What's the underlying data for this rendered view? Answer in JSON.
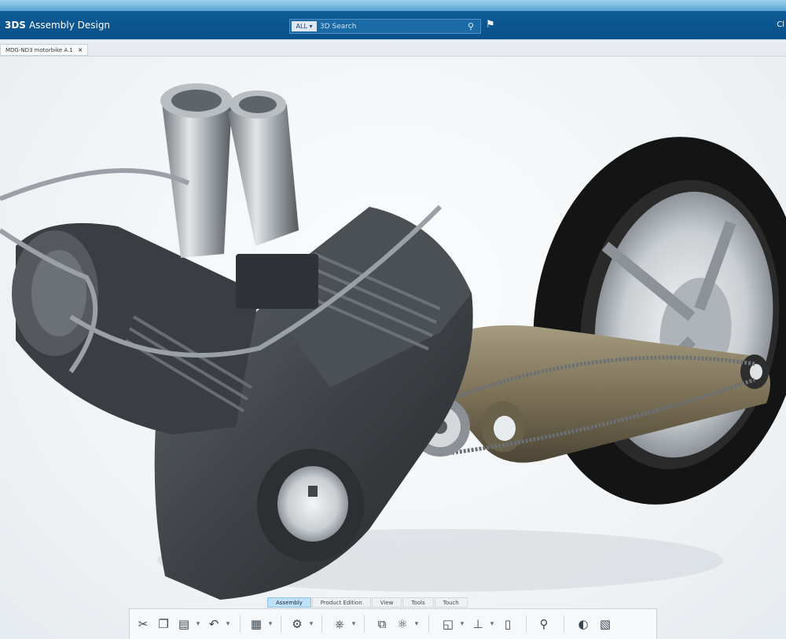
{
  "app": {
    "brand": "3DS",
    "title": "Assembly Design",
    "right_label": "Cl"
  },
  "search": {
    "scope": "ALL ▾",
    "placeholder": "3D Search"
  },
  "document_tab": {
    "label": "MDG-ND3 motorbike A.1"
  },
  "action_bar": {
    "tabs": [
      "Assembly",
      "Product Edition",
      "View",
      "Tools",
      "Touch"
    ],
    "active_tab": "Assembly"
  },
  "icons": {
    "search": "search-icon",
    "tag": "tag-icon",
    "close": "close-icon"
  },
  "colors": {
    "topbar": "#0a5189",
    "swingarm": "#7d7258",
    "engine": "#3e4246",
    "tire": "#141414"
  }
}
